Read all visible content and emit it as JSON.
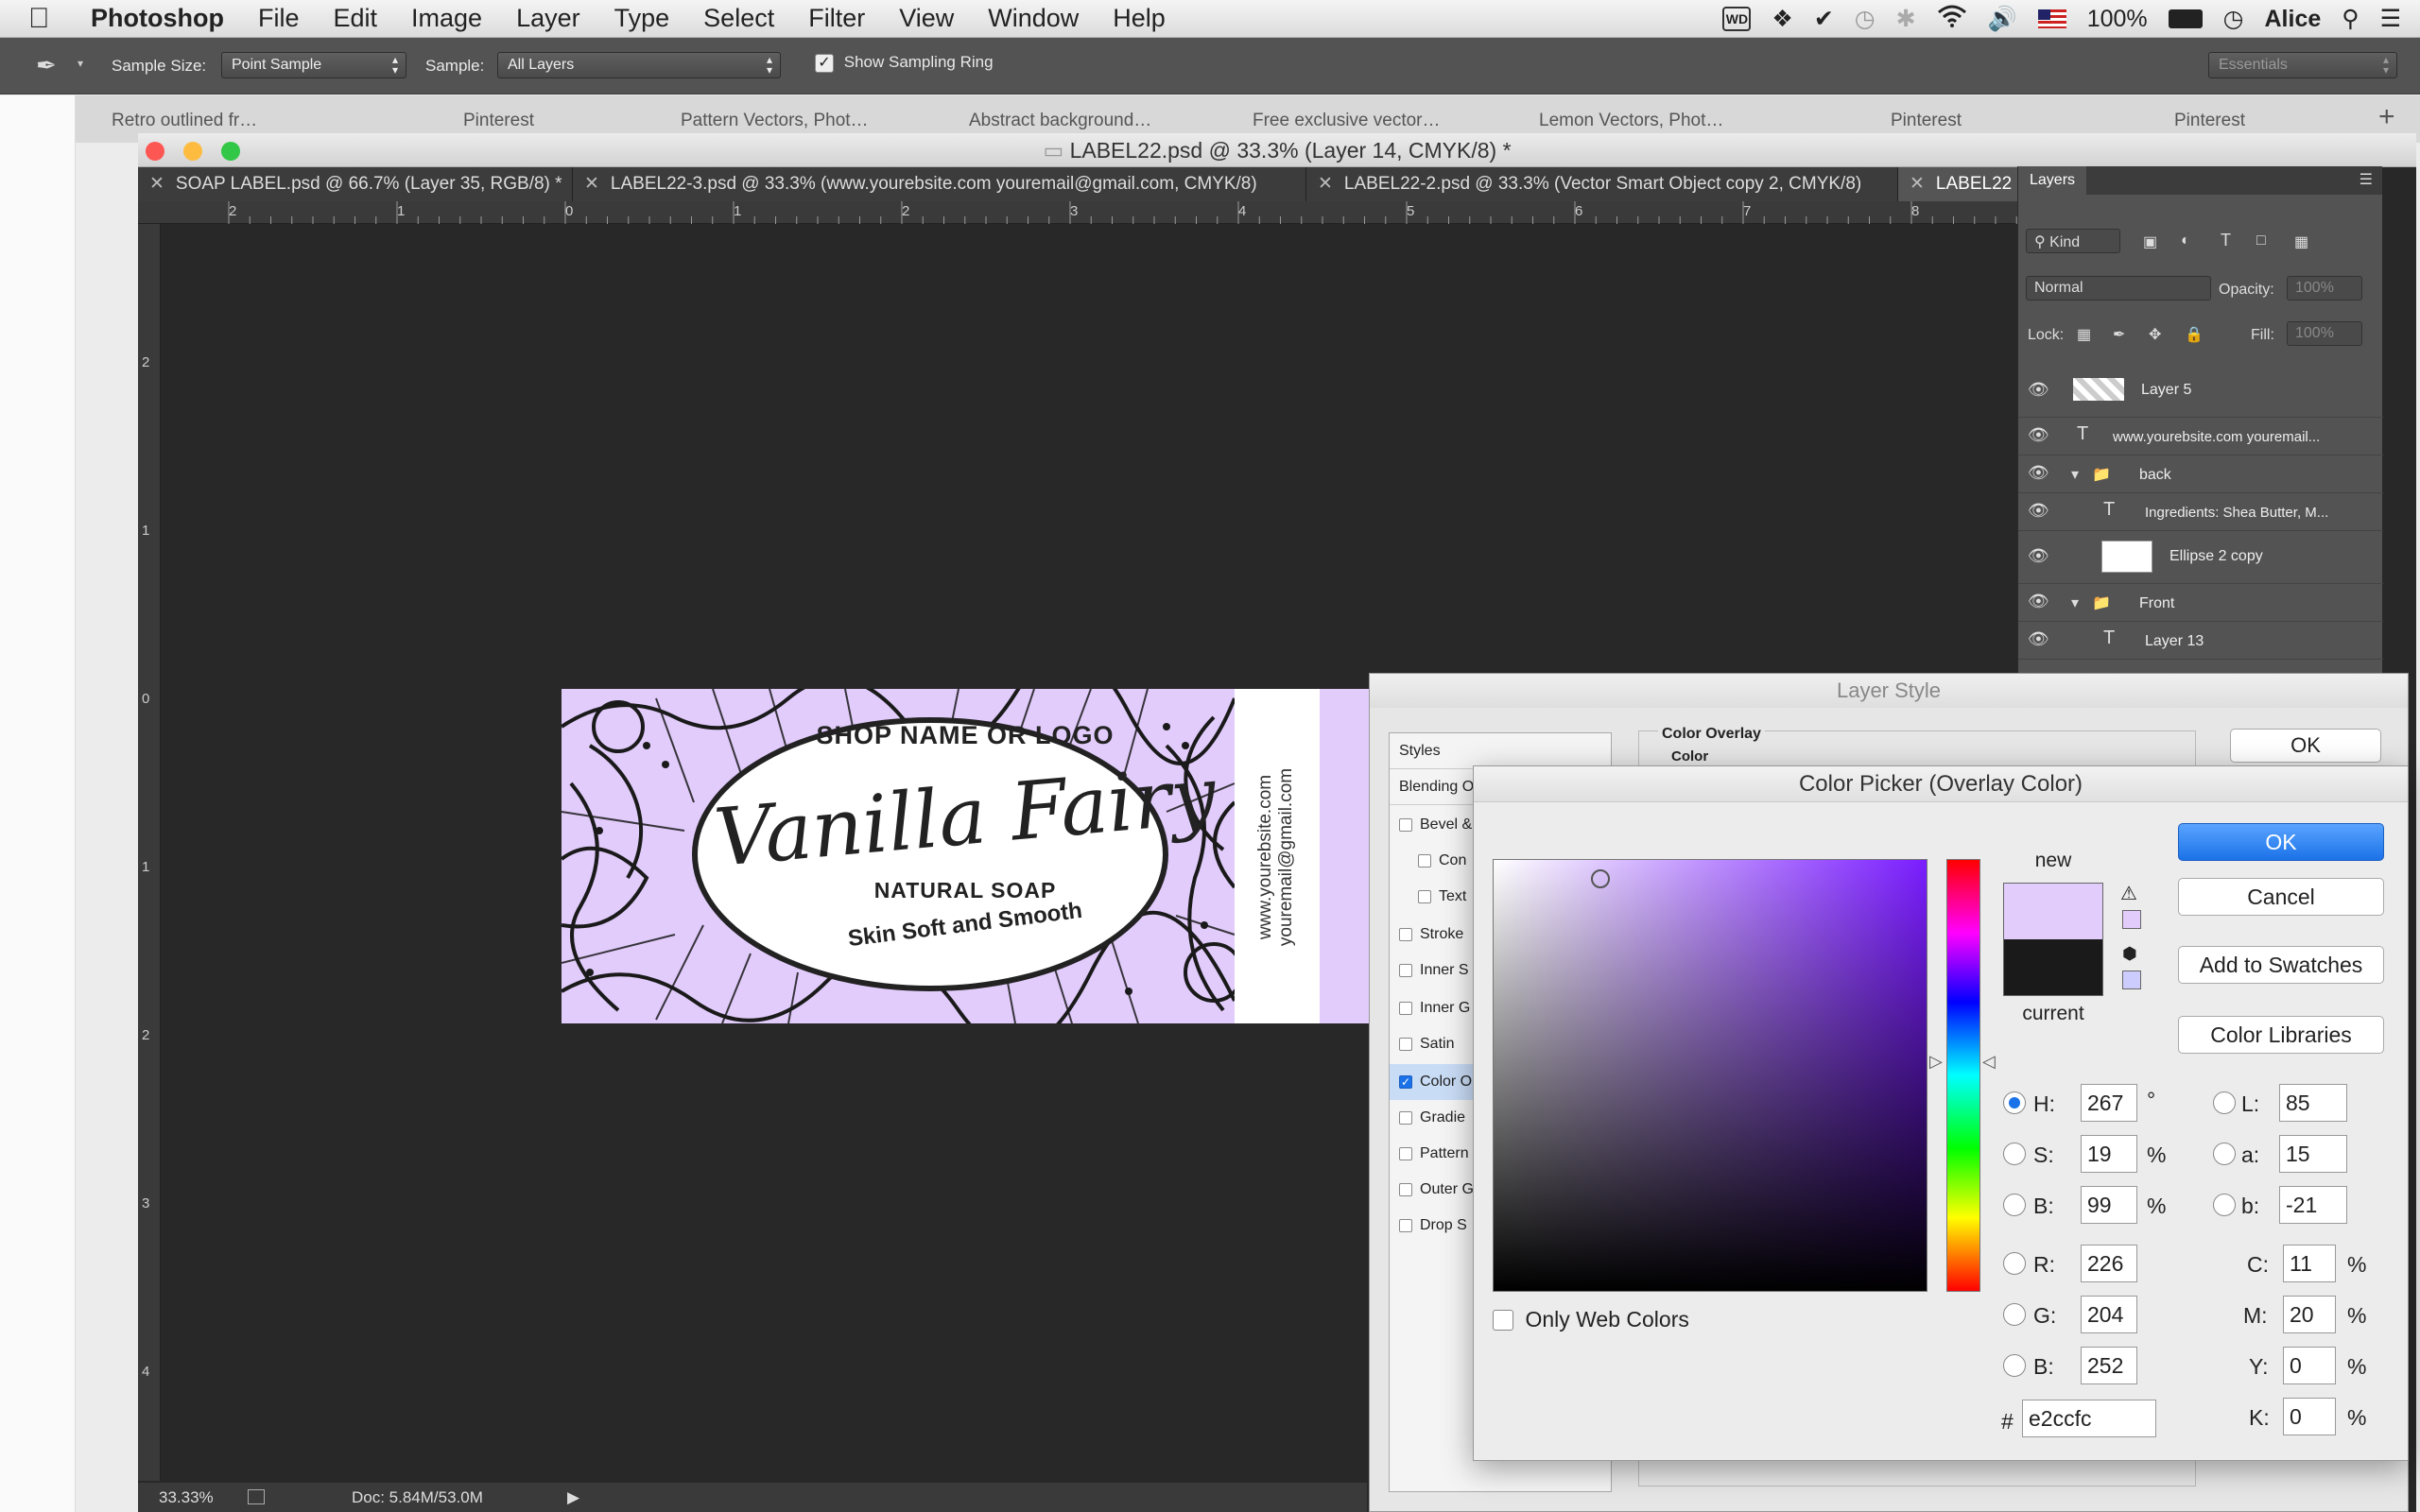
{
  "menubar": {
    "app_name": "Photoshop",
    "menus": [
      "File",
      "Edit",
      "Image",
      "Layer",
      "Type",
      "Select",
      "Filter",
      "View",
      "Window",
      "Help"
    ],
    "battery": "100%",
    "user": "Alice"
  },
  "options": {
    "sample_size_label": "Sample Size:",
    "sample_size_value": "Point Sample",
    "sample_label": "Sample:",
    "sample_value": "All Layers",
    "show_sampling_ring": "Show Sampling Ring",
    "workspace": "Essentials"
  },
  "browser_tabs": [
    "Retro outlined fr…",
    "Pinterest",
    "Pattern Vectors, Phot…",
    "Abstract background…",
    "Free exclusive vector…",
    "Lemon Vectors, Phot…",
    "Pinterest",
    "Pinterest"
  ],
  "document": {
    "title": "LABEL22.psd @ 33.3% (Layer 14, CMYK/8) *",
    "tabs": [
      "SOAP LABEL.psd @ 66.7% (Layer 35, RGB/8) *",
      "LABEL22-3.psd @ 33.3% (www.yourebsite.com youremail@gmail.com, CMYK/8)",
      "LABEL22-2.psd @ 33.3% (Vector Smart Object copy 2, CMYK/8)",
      "LABEL22"
    ],
    "hruler_labels": [
      "2",
      "1",
      "0",
      "1",
      "2",
      "3",
      "4",
      "5",
      "6",
      "7",
      "8"
    ],
    "vruler_labels": [
      "2",
      "1",
      "0",
      "1",
      "2",
      "3",
      "4"
    ],
    "zoom": "33.33%",
    "doc_size": "Doc: 5.84M/53.0M"
  },
  "label_art": {
    "shop": "SHOP NAME OR LOGO",
    "name": "Vanilla Fairy",
    "type": "NATURAL SOAP",
    "tagline": "Skin Soft and Smooth",
    "website": "www.yourebsite.com",
    "email": "youremail@gmail.com",
    "tint_color": "#e2ccfc"
  },
  "layers_panel": {
    "title": "Layers",
    "kind": "Kind",
    "blend_mode": "Normal",
    "opacity_label": "Opacity:",
    "opacity_value": "100%",
    "lock_label": "Lock:",
    "fill_label": "Fill:",
    "fill_value": "100%",
    "layers": [
      {
        "name": "Layer 5",
        "kind": "pixel"
      },
      {
        "name": "www.yourebsite.com youremail...",
        "kind": "text"
      },
      {
        "name": "back",
        "kind": "group"
      },
      {
        "name": "Ingredients: Shea Butter, M...",
        "kind": "text"
      },
      {
        "name": "Ellipse 2 copy",
        "kind": "shape"
      },
      {
        "name": "Front",
        "kind": "group"
      },
      {
        "name": "Layer 13",
        "kind": "text"
      }
    ]
  },
  "layer_style": {
    "title": "Layer Style",
    "styles_header": "Styles",
    "blending_options": "Blending O",
    "items": [
      "Bevel &",
      "Con",
      "Text",
      "Stroke",
      "Inner S",
      "Inner G",
      "Satin",
      "Color O",
      "Gradie",
      "Pattern",
      "Outer G",
      "Drop S"
    ],
    "section_title": "Color Overlay",
    "sub_title": "Color",
    "ok": "OK"
  },
  "color_picker": {
    "title": "Color Picker (Overlay Color)",
    "new_label": "new",
    "current_label": "current",
    "ok": "OK",
    "cancel": "Cancel",
    "add_to_swatches": "Add to Swatches",
    "color_libraries": "Color Libraries",
    "only_web_colors": "Only Web Colors",
    "new_color": "#e2ccfc",
    "current_color": "#1a1a1a",
    "hsb": {
      "H": "267",
      "S": "19",
      "B": "99"
    },
    "rgb": {
      "R": "226",
      "G": "204",
      "B": "252"
    },
    "lab": {
      "L": "85",
      "a": "15",
      "b": "-21"
    },
    "cmyk": {
      "C": "11",
      "M": "20",
      "Y": "0",
      "K": "0"
    },
    "hex": "e2ccfc",
    "units": {
      "degree": "°",
      "percent": "%"
    },
    "labels": {
      "H": "H:",
      "S": "S:",
      "Bb": "B:",
      "R": "R:",
      "G": "G:",
      "Brgb": "B:",
      "L": "L:",
      "a": "a:",
      "b": "b:",
      "C": "C:",
      "M": "M:",
      "Y": "Y:",
      "K": "K:",
      "hash": "#"
    }
  }
}
